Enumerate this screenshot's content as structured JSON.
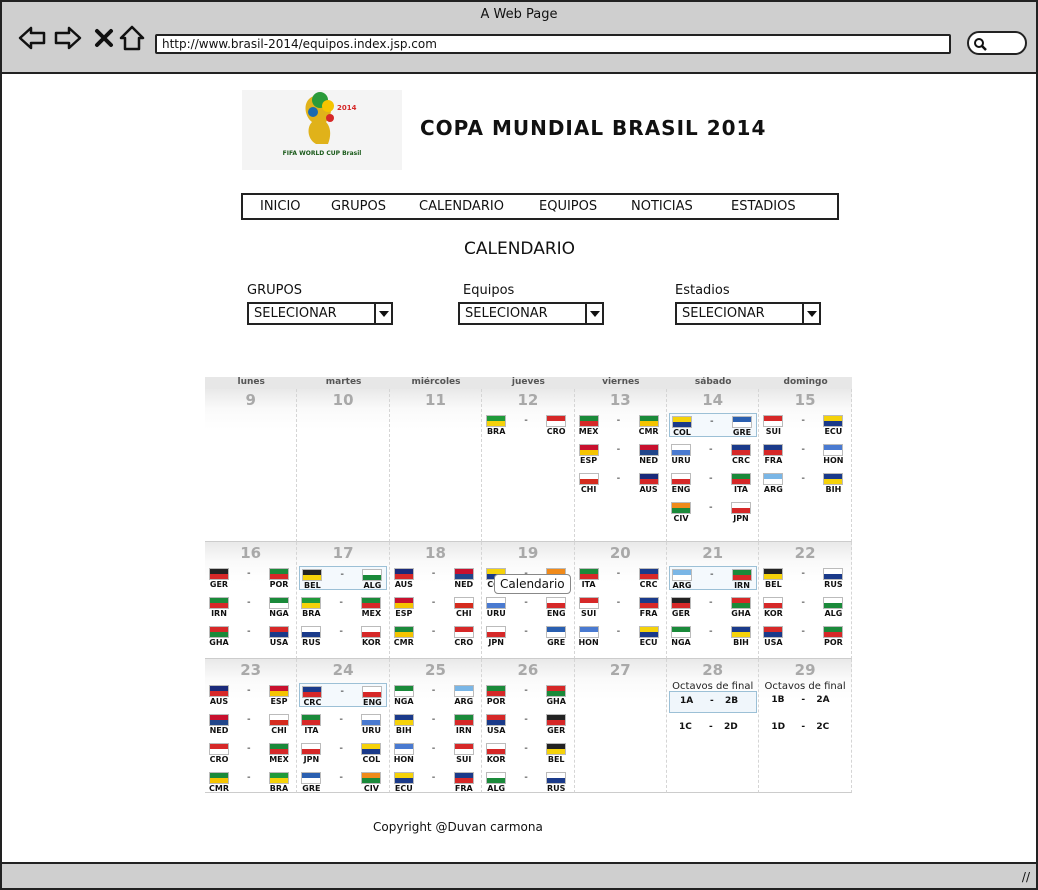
{
  "window": {
    "title": "A Web Page",
    "url": "http://www.brasil-2014/equipos.index.jsp.com"
  },
  "logo": {
    "text": "FIFA WORLD CUP Brasil"
  },
  "header": {
    "title": "COPA MUNDIAL BRASIL 2014"
  },
  "nav": [
    "INICIO",
    "GRUPOS",
    "CALENDARIO",
    "EQUIPOS",
    "NOTICIAS",
    "ESTADIOS"
  ],
  "section": {
    "title": "CALENDARIO"
  },
  "filters": [
    {
      "label": "GRUPOS",
      "value": "SELECIONAR"
    },
    {
      "label": "Equipos",
      "value": "SELECIONAR"
    },
    {
      "label": "Estadios",
      "value": "SELECIONAR"
    }
  ],
  "calendar": {
    "weekdays": [
      "lunes",
      "martes",
      "miércoles",
      "jueves",
      "viernes",
      "sábado",
      "domingo"
    ],
    "weeks": [
      [
        {
          "day": "9",
          "matches": []
        },
        {
          "day": "10",
          "matches": []
        },
        {
          "day": "11",
          "matches": []
        },
        {
          "day": "12",
          "matches": [
            [
              "BRA",
              "CRO"
            ]
          ]
        },
        {
          "day": "13",
          "matches": [
            [
              "MEX",
              "CMR"
            ],
            [
              "ESP",
              "NED"
            ],
            [
              "CHI",
              "AUS"
            ]
          ]
        },
        {
          "day": "14",
          "matches": [
            [
              "COL",
              "GRE"
            ],
            [
              "URU",
              "CRC"
            ],
            [
              "ENG",
              "ITA"
            ],
            [
              "CIV",
              "JPN"
            ]
          ],
          "highlight": 0
        },
        {
          "day": "15",
          "matches": [
            [
              "SUI",
              "ECU"
            ],
            [
              "FRA",
              "HON"
            ],
            [
              "ARG",
              "BIH"
            ]
          ]
        }
      ],
      [
        {
          "day": "16",
          "matches": [
            [
              "GER",
              "POR"
            ],
            [
              "IRN",
              "NGA"
            ],
            [
              "GHA",
              "USA"
            ]
          ]
        },
        {
          "day": "17",
          "matches": [
            [
              "BEL",
              "ALG"
            ],
            [
              "BRA",
              "MEX"
            ],
            [
              "RUS",
              "KOR"
            ]
          ],
          "highlight": 0
        },
        {
          "day": "18",
          "matches": [
            [
              "AUS",
              "NED"
            ],
            [
              "ESP",
              "CHI"
            ],
            [
              "CMR",
              "CRO"
            ]
          ]
        },
        {
          "day": "19",
          "matches": [
            [
              "COL",
              "CIV"
            ],
            [
              "URU",
              "ENG"
            ],
            [
              "JPN",
              "GRE"
            ]
          ]
        },
        {
          "day": "20",
          "matches": [
            [
              "ITA",
              "CRC"
            ],
            [
              "SUI",
              "FRA"
            ],
            [
              "HON",
              "ECU"
            ]
          ]
        },
        {
          "day": "21",
          "matches": [
            [
              "ARG",
              "IRN"
            ],
            [
              "GER",
              "GHA"
            ],
            [
              "NGA",
              "BIH"
            ]
          ],
          "highlight": 0
        },
        {
          "day": "22",
          "matches": [
            [
              "BEL",
              "RUS"
            ],
            [
              "KOR",
              "ALG"
            ],
            [
              "USA",
              "POR"
            ]
          ]
        }
      ],
      [
        {
          "day": "23",
          "matches": [
            [
              "AUS",
              "ESP"
            ],
            [
              "NED",
              "CHI"
            ],
            [
              "CRO",
              "MEX"
            ],
            [
              "CMR",
              "BRA"
            ]
          ]
        },
        {
          "day": "24",
          "matches": [
            [
              "CRC",
              "ENG"
            ],
            [
              "ITA",
              "URU"
            ],
            [
              "JPN",
              "COL"
            ],
            [
              "GRE",
              "CIV"
            ]
          ],
          "highlight": 0
        },
        {
          "day": "25",
          "matches": [
            [
              "NGA",
              "ARG"
            ],
            [
              "BIH",
              "IRN"
            ],
            [
              "HON",
              "SUI"
            ],
            [
              "ECU",
              "FRA"
            ]
          ]
        },
        {
          "day": "26",
          "matches": [
            [
              "POR",
              "GHA"
            ],
            [
              "USA",
              "GER"
            ],
            [
              "KOR",
              "BEL"
            ],
            [
              "ALG",
              "RUS"
            ]
          ]
        },
        {
          "day": "27",
          "matches": []
        },
        {
          "day": "28",
          "octavos": "Octavos de final",
          "knockout": [
            [
              "1A",
              "2B"
            ],
            [
              "1C",
              "2D"
            ]
          ],
          "highlight": 0
        },
        {
          "day": "29",
          "octavos": "Octavos de final",
          "knockout": [
            [
              "1B",
              "2A"
            ],
            [
              "1D",
              "2C"
            ]
          ]
        }
      ]
    ]
  },
  "tooltip": "Calendario",
  "flags": {
    "BRA": [
      "#1f9a3a",
      "#f5d20a"
    ],
    "CRO": [
      "#d62828",
      "#ffffff"
    ],
    "MEX": [
      "#1a8a3a",
      "#d62828"
    ],
    "CMR": [
      "#1a8a3a",
      "#f5c400"
    ],
    "ESP": [
      "#c8102e",
      "#f5c400"
    ],
    "NED": [
      "#c8102e",
      "#21468b"
    ],
    "CHI": [
      "#ffffff",
      "#d52b1e"
    ],
    "AUS": [
      "#1a2a7a",
      "#d62828"
    ],
    "COL": [
      "#f5d20a",
      "#1a3a8a"
    ],
    "GRE": [
      "#2a5fb0",
      "#ffffff"
    ],
    "URU": [
      "#ffffff",
      "#4a7ad0"
    ],
    "CRC": [
      "#1a3a8a",
      "#d62828"
    ],
    "ENG": [
      "#ffffff",
      "#d62828"
    ],
    "ITA": [
      "#1a8a3a",
      "#d62828"
    ],
    "CIV": [
      "#f08a1a",
      "#1a8a3a"
    ],
    "JPN": [
      "#ffffff",
      "#d62828"
    ],
    "SUI": [
      "#d62828",
      "#ffffff"
    ],
    "ECU": [
      "#f5d20a",
      "#1a3a8a"
    ],
    "FRA": [
      "#1a3a8a",
      "#d62828"
    ],
    "HON": [
      "#4a7ad0",
      "#ffffff"
    ],
    "ARG": [
      "#7ab6e6",
      "#ffffff"
    ],
    "BIH": [
      "#1a3a8a",
      "#f5d20a"
    ],
    "GER": [
      "#222222",
      "#d62828"
    ],
    "POR": [
      "#1a8a3a",
      "#d62828"
    ],
    "IRN": [
      "#1a8a3a",
      "#d62828"
    ],
    "NGA": [
      "#1a8a3a",
      "#ffffff"
    ],
    "GHA": [
      "#d62828",
      "#1a8a3a"
    ],
    "USA": [
      "#d62828",
      "#1a3a8a"
    ],
    "BEL": [
      "#222222",
      "#f5d20a"
    ],
    "ALG": [
      "#ffffff",
      "#1a8a3a"
    ],
    "RUS": [
      "#ffffff",
      "#1a3a8a"
    ],
    "KOR": [
      "#ffffff",
      "#d62828"
    ]
  },
  "footer": {
    "copyright": "Copyright @Duvan carmona"
  }
}
